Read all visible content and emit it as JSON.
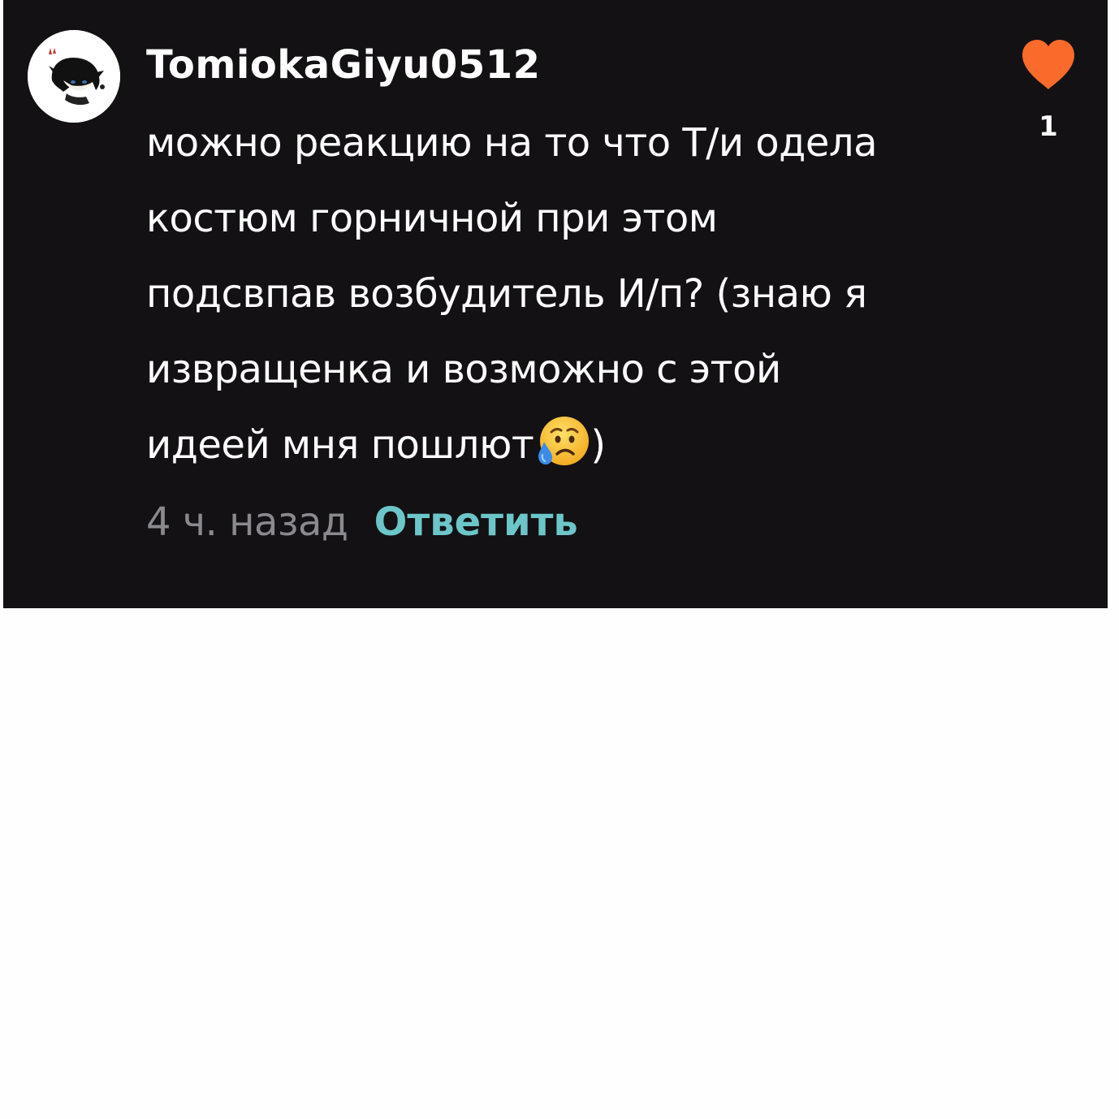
{
  "comment": {
    "username": "TomiokaGiyu0512",
    "text_lines": [
      "можно реакцию на то что Т/и одела",
      "костюм горничной при этом",
      "подсвпав возбудитель И/п? (знаю я",
      "извращенка и возможно с этой",
      "идеей мня пошлют"
    ],
    "text_tail": ")",
    "emoji": "sad-but-relieved-face",
    "timestamp": "4 ч. назад",
    "reply_label": "Ответить",
    "like_count": "1"
  },
  "icons": {
    "avatar": "avatar-anime-character",
    "like": "heart-icon"
  },
  "colors": {
    "card_background": "#131114",
    "page_background": "#fefefe",
    "text": "#ffffff",
    "timestamp": "#8a8a8e",
    "reply": "#6cc6c9",
    "heart": "#fa6a2b"
  }
}
